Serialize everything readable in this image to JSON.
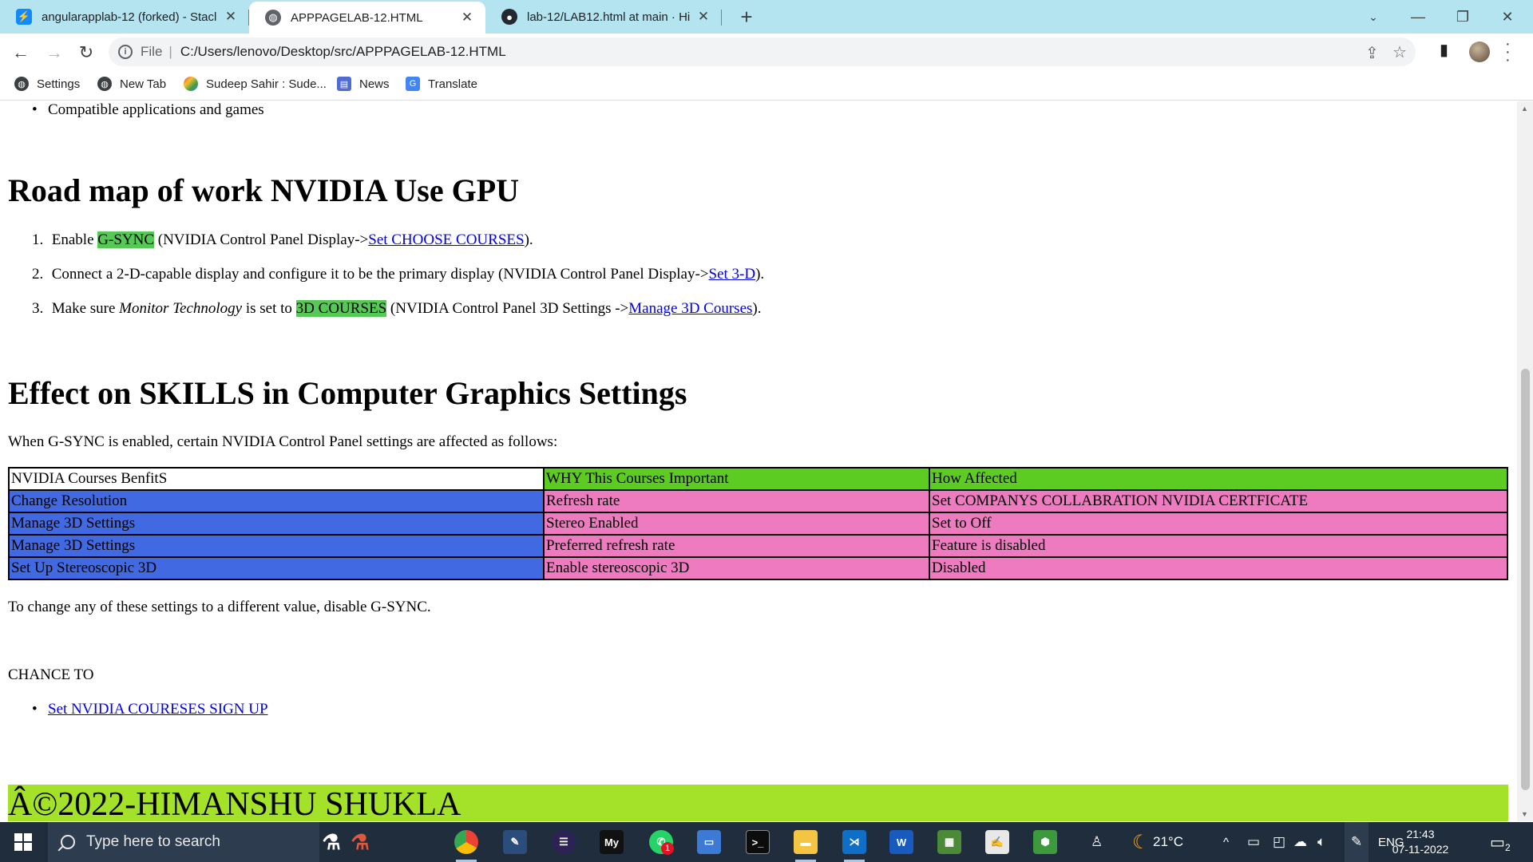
{
  "browser": {
    "tabs": [
      {
        "title": "angularapplab-12 (forked) - Stacl",
        "icon": "stackblitz-icon",
        "active": false
      },
      {
        "title": "APPPAGELAB-12.HTML",
        "icon": "globe-icon",
        "active": true
      },
      {
        "title": "lab-12/LAB12.html at main · Him",
        "icon": "github-icon",
        "active": false
      }
    ],
    "address": {
      "scheme": "File",
      "path": "C:/Users/lenovo/Desktop/src/APPPAGELAB-12.HTML"
    },
    "bookmarks": [
      {
        "label": "Settings",
        "icon": "settings-globe-icon"
      },
      {
        "label": "New Tab",
        "icon": "globe-icon"
      },
      {
        "label": "Sudeep Sahir : Sude...",
        "icon": "bookmark-favicon-icon"
      },
      {
        "label": "News",
        "icon": "news-icon"
      },
      {
        "label": "Translate",
        "icon": "translate-icon"
      }
    ]
  },
  "page": {
    "top_bullet": "Compatible applications and games",
    "heading1": "Road map of work NVIDIA Use GPU",
    "roadmap": {
      "item1": {
        "num": "1.",
        "pre": "Enable ",
        "hl": "G-SYNC",
        "mid": " (NVIDIA Control Panel Display->",
        "link": "Set CHOOSE COURSES",
        "post": ")."
      },
      "item2": {
        "num": "2.",
        "pre": "Connect a 2-D-capable display and configure it to be the primary display (NVIDIA Control Panel Display->",
        "link": "Set 3-D",
        "post": ")."
      },
      "item3": {
        "num": "3.",
        "pre": "Make sure ",
        "em": "Monitor Technology",
        "mid1": " is set to ",
        "hl": "3D COURSES",
        "mid2": " (NVIDIA Control Panel 3D Settings ->",
        "link": "Manage 3D Courses",
        "post": ")."
      }
    },
    "heading2": "Effect on SKILLS in Computer Graphics Settings",
    "intro": "When G-SYNC is enabled, certain NVIDIA Control Panel settings are affected as follows:",
    "table": {
      "headers": [
        "NVIDIA Courses BenfitS",
        "WHY This Courses Important",
        "How Affected"
      ],
      "rows": [
        [
          "Change Resolution",
          "Refresh rate",
          "Set COMPANYS COLLABRATION NVIDIA CERTFICATE"
        ],
        [
          "Manage 3D Settings",
          "Stereo Enabled",
          "Set to Off"
        ],
        [
          "Manage 3D Settings",
          "Preferred refresh rate",
          "Feature is disabled"
        ],
        [
          "Set Up Stereoscopic 3D",
          "Enable stereoscopic 3D",
          "Disabled"
        ]
      ]
    },
    "after_table": "To change any of these settings to a different value, disable G-SYNC.",
    "chance": "CHANCE TO",
    "signup_link": "Set NVIDIA COURESES SIGN UP",
    "footer": "Â©2022-HIMANSHU SHUKLA"
  },
  "taskbar": {
    "search_placeholder": "Type here to search",
    "weather": "21°C",
    "lang": "ENG",
    "time": "21:43",
    "date": "07-11-2022",
    "notifications": "2",
    "whatsapp_badge": "1"
  },
  "colors": {
    "tabstrip": "#b3e4f0",
    "highlight_green": "#55c855",
    "table_header_green": "#5ccb22",
    "table_blue": "#4169e1",
    "table_pink": "#ee7bc0",
    "footer_lime": "#a4e22a",
    "taskbar": "#1f2d3d"
  }
}
